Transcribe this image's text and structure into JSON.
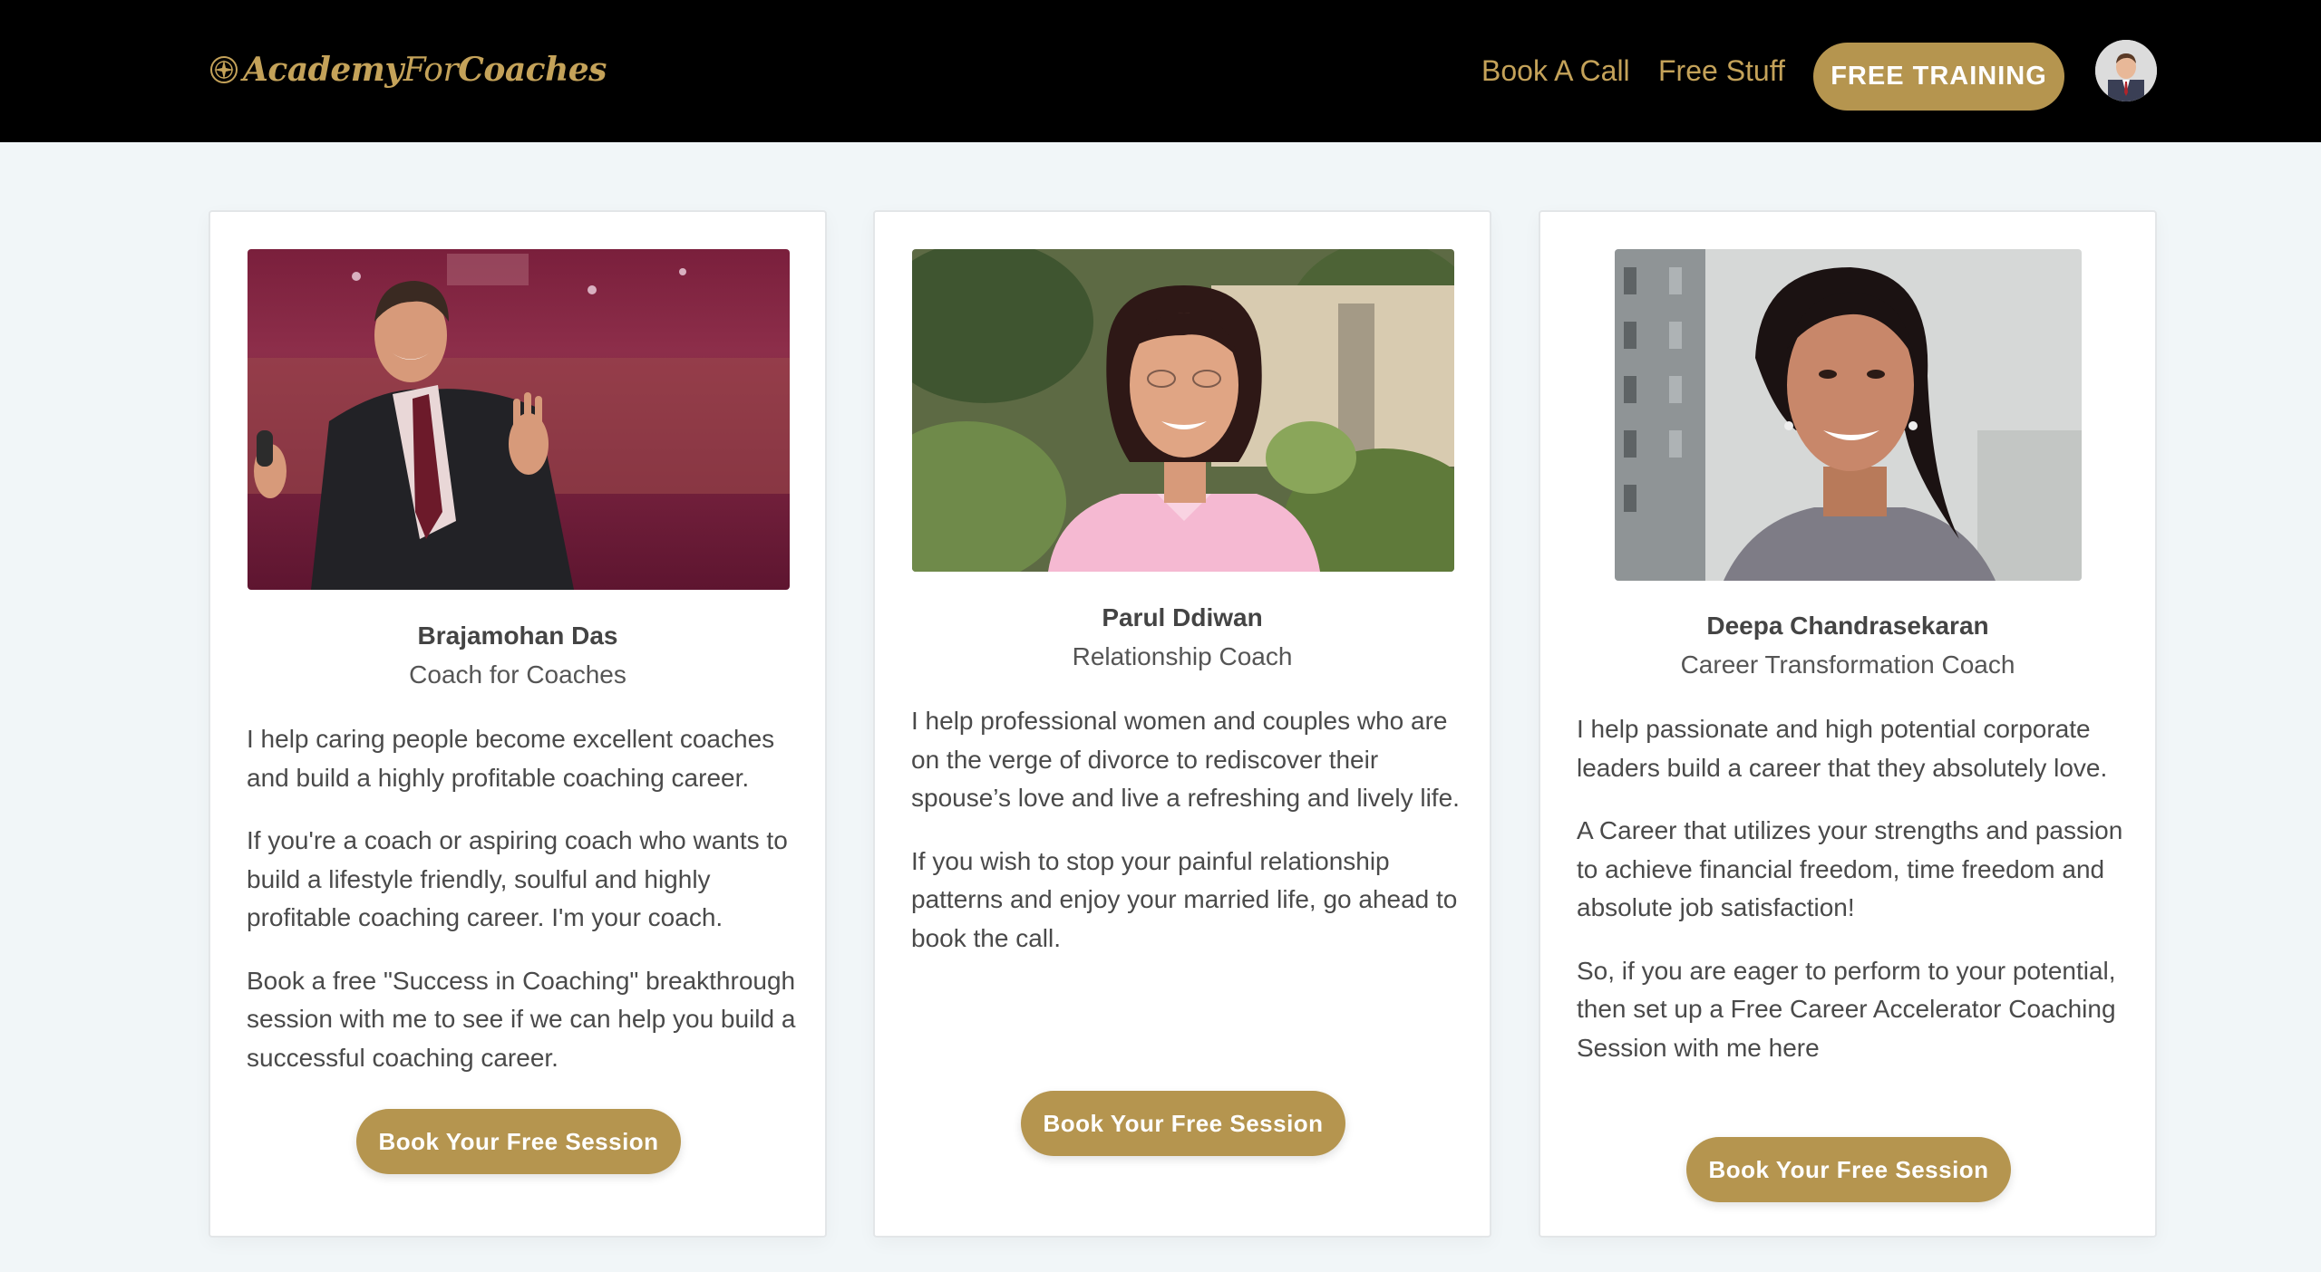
{
  "header": {
    "logo_part1": "Academy",
    "logo_part2": "For",
    "logo_part3": "Coaches",
    "nav": {
      "book_call": "Book A Call",
      "free_stuff": "Free Stuff",
      "free_training": "FREE TRAINING"
    }
  },
  "colors": {
    "header_bg": "#000000",
    "brand_gold": "#c4a259",
    "button_gold": "#b5954f",
    "page_bg": "#f1f6f8"
  },
  "coaches": [
    {
      "name": "Brajamohan Das",
      "role": "Coach for Coaches",
      "bio": [
        "I help caring people become excellent coaches and build a highly profitable coaching career.",
        "If you're a coach or aspiring coach who wants to build a lifestyle friendly, soulful and highly profitable coaching career. I'm your coach.",
        "Book a free \"Success in Coaching\" breakthrough session with me to see if we can help you build a successful coaching career."
      ],
      "button": "Book Your Free Session"
    },
    {
      "name": "Parul Ddiwan",
      "role": "Relationship Coach",
      "bio": [
        "I help professional women and couples who are on the verge of divorce to rediscover their spouse’s love and live a refreshing and lively life.",
        "If you wish to stop your painful relationship patterns and enjoy your married life, go ahead to book the call."
      ],
      "button": "Book Your Free Session"
    },
    {
      "name": "Deepa Chandrasekaran",
      "role": "Career Transformation Coach",
      "bio": [
        "I help passionate and high potential corporate leaders build a career that they absolutely love.",
        "A Career that utilizes your strengths and passion to achieve financial freedom, time freedom and absolute job satisfaction!",
        "So, if you are eager to perform to your potential, then set up a Free Career Accelerator Coaching Session with me here"
      ],
      "button": "Book Your Free Session"
    }
  ]
}
